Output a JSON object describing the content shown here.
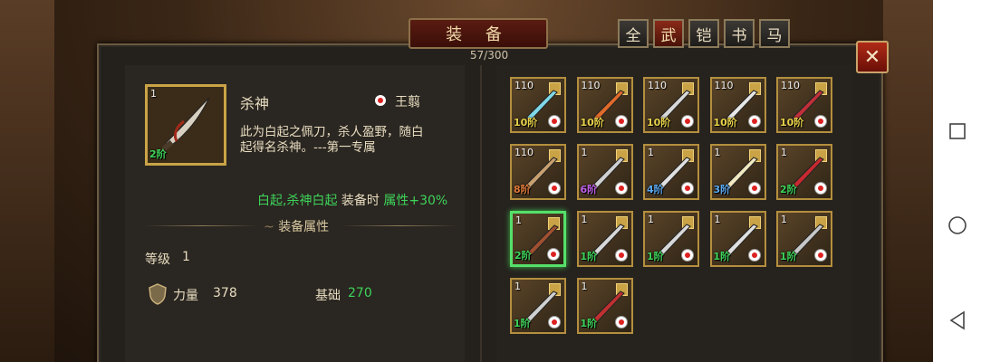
{
  "panel": {
    "title": "装 备",
    "capacity": "57/300",
    "close_icon": "close-icon"
  },
  "tabs": [
    {
      "label": "全",
      "active": false
    },
    {
      "label": "武",
      "active": true
    },
    {
      "label": "铠",
      "active": false
    },
    {
      "label": "书",
      "active": false
    },
    {
      "label": "马",
      "active": false
    }
  ],
  "detail": {
    "level_badge": "1",
    "star_label": "2阶",
    "name": "杀神",
    "owner": "王翦",
    "description_line1": "此为白起之佩刀，杀人盈野，随白",
    "description_line2": "起得名杀神。---第一专属",
    "bonus_part1": "白起,杀神白起",
    "bonus_part2": " 装备时 ",
    "bonus_part3": "属性+30%",
    "section_title": "装备属性",
    "level_label": "等级",
    "level_value": "1",
    "power_label": "力量",
    "power_value": "378",
    "base_label": "基础",
    "base_value": "270"
  },
  "grid": [
    {
      "level": "110",
      "star": "10阶",
      "star_color": "#e8d24a",
      "blade": "#7fd9e8",
      "selected": false
    },
    {
      "level": "110",
      "star": "10阶",
      "star_color": "#e8d24a",
      "blade": "#e06a2a",
      "selected": false
    },
    {
      "level": "110",
      "star": "10阶",
      "star_color": "#e8d24a",
      "blade": "#d8d8d8",
      "selected": false
    },
    {
      "level": "110",
      "star": "10阶",
      "star_color": "#e8d24a",
      "blade": "#e8e8e8",
      "selected": false
    },
    {
      "level": "110",
      "star": "10阶",
      "star_color": "#e8d24a",
      "blade": "#c0303a",
      "selected": false
    },
    {
      "level": "110",
      "star": "8阶",
      "star_color": "#e07a3a",
      "blade": "#c8a070",
      "selected": false
    },
    {
      "level": "1",
      "star": "6阶",
      "star_color": "#c060e8",
      "blade": "#d0d0d0",
      "selected": false
    },
    {
      "level": "1",
      "star": "4阶",
      "star_color": "#5aa8f0",
      "blade": "#e0e0e0",
      "selected": false
    },
    {
      "level": "1",
      "star": "3阶",
      "star_color": "#5aa8f0",
      "blade": "#f0e8c0",
      "selected": false
    },
    {
      "level": "1",
      "star": "2阶",
      "star_color": "#3ed35a",
      "blade": "#c82a30",
      "selected": false
    },
    {
      "level": "1",
      "star": "2阶",
      "star_color": "#3ed35a",
      "blade": "#a05030",
      "selected": true
    },
    {
      "level": "1",
      "star": "1阶",
      "star_color": "#3ed35a",
      "blade": "#d8d8d8",
      "selected": false
    },
    {
      "level": "1",
      "star": "1阶",
      "star_color": "#3ed35a",
      "blade": "#d8d8d8",
      "selected": false
    },
    {
      "level": "1",
      "star": "1阶",
      "star_color": "#3ed35a",
      "blade": "#e0e0e0",
      "selected": false
    },
    {
      "level": "1",
      "star": "1阶",
      "star_color": "#3ed35a",
      "blade": "#c8c8c8",
      "selected": false
    },
    {
      "level": "1",
      "star": "1阶",
      "star_color": "#3ed35a",
      "blade": "#d0d0d0",
      "selected": false
    },
    {
      "level": "1",
      "star": "1阶",
      "star_color": "#3ed35a",
      "blade": "#c03030",
      "selected": false
    }
  ],
  "colors": {
    "accent_gold": "#c9a346",
    "highlight_green": "#3ed35a",
    "close_red": "#b02a16"
  },
  "system_nav": {
    "square_icon": "recent-apps-icon",
    "circle_icon": "home-icon",
    "triangle_icon": "back-icon"
  }
}
